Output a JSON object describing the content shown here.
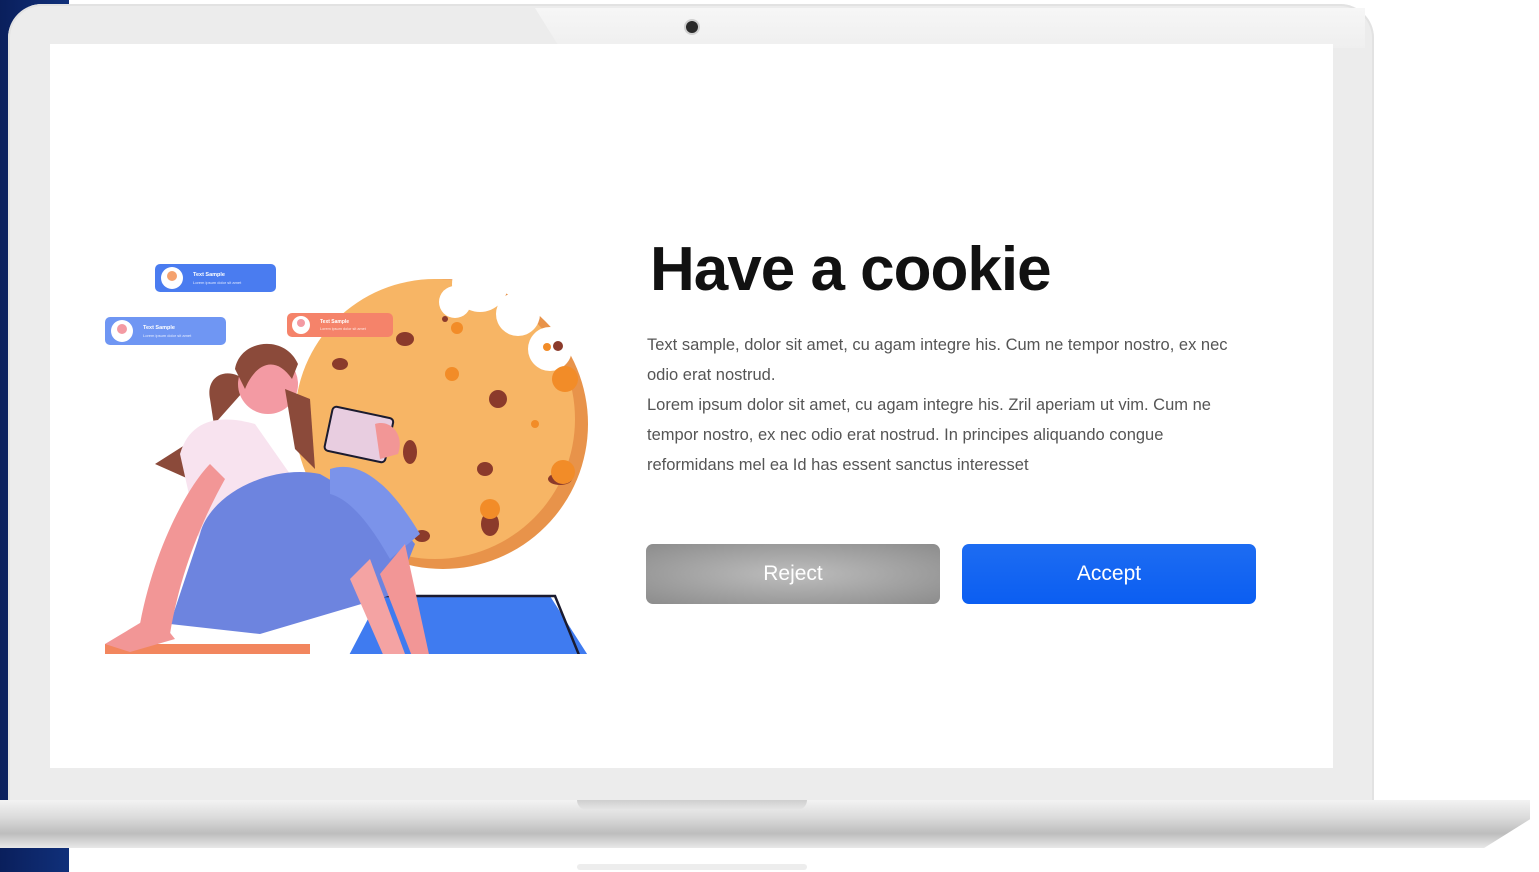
{
  "colors": {
    "accent": "#0b5ef2",
    "reject_button": "#999999",
    "title": "#111111",
    "body_text": "#555555",
    "background_strip": "#0a1f5c"
  },
  "cookie_dialog": {
    "title": "Have a cookie",
    "body_lines": [
      "Text sample, dolor sit amet, cu agam integre his. Cum ne tempor nostro, ex nec odio erat nostrud.",
      "Lorem ipsum dolor sit amet, cu agam integre his. Zril aperiam ut vim. Cum ne tempor nostro, ex nec odio erat nostrud. In principes aliquando congue reformidans mel ea  Id has essent sanctus interesset"
    ],
    "reject_label": "Reject",
    "accept_label": "Accept"
  },
  "illustration": {
    "chat_bubbles": [
      {
        "title": "Text Sample",
        "subtitle": "Lorem ipsum dolor sit amet",
        "color": "#4a7cf0"
      },
      {
        "title": "Text Sample",
        "subtitle": "Lorem ipsum dolor sit amet",
        "color": "#6f96f3"
      },
      {
        "title": "Text Sample",
        "subtitle": "Lorem ipsum dolor sit amet",
        "color": "#f5836a"
      }
    ]
  }
}
